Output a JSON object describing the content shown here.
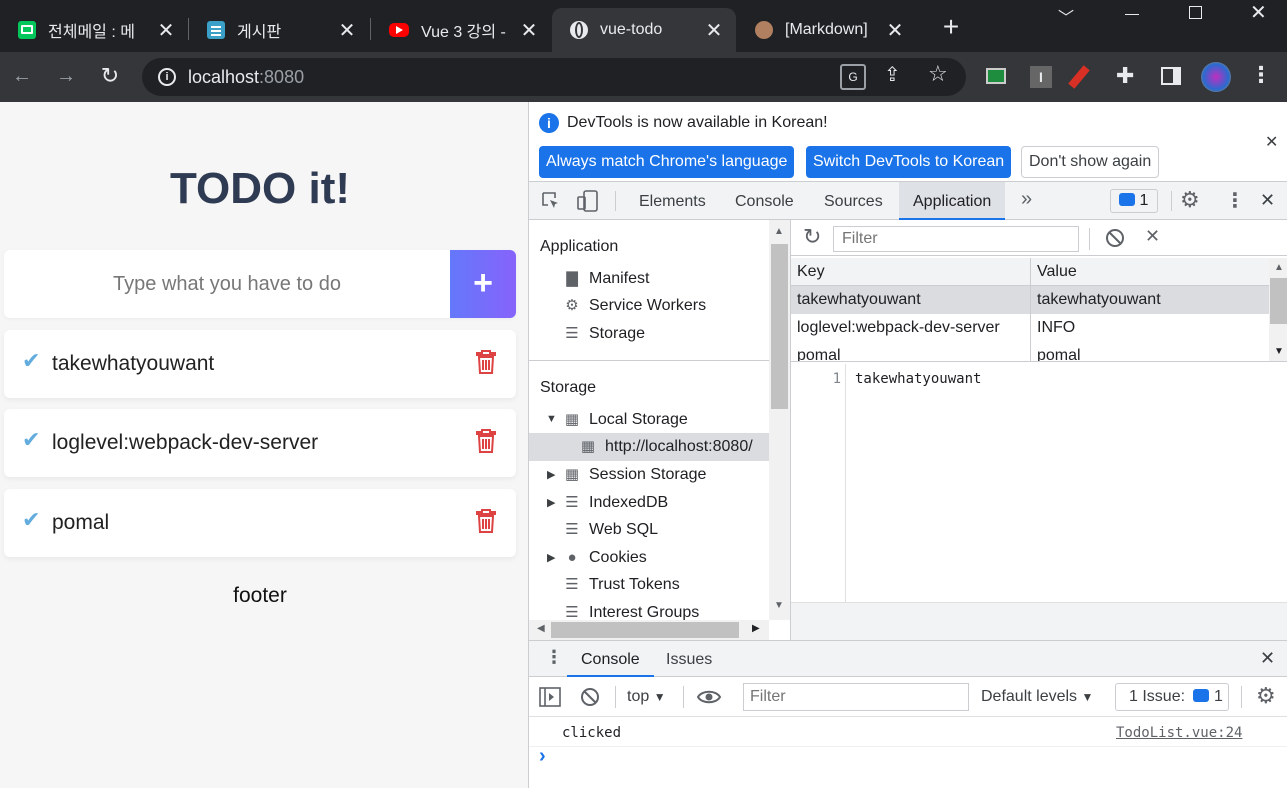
{
  "browser": {
    "tabs": [
      {
        "title": "전체메일 : 메",
        "favicon_color": "#03c75a",
        "icon": "mail-icon"
      },
      {
        "title": "게시판",
        "favicon_color": "#3aa0c8",
        "icon": "clipboard-icon"
      },
      {
        "title": "Vue 3 강의 -",
        "favicon_color": "#ff0000",
        "icon": "youtube-icon"
      },
      {
        "title": "vue-todo",
        "favicon_color": "#e8eaed",
        "icon": "globe-icon",
        "active": true
      },
      {
        "title": "[Markdown]",
        "favicon_color": "#b08060",
        "icon": "avatar-icon"
      }
    ],
    "new_tab": "+",
    "url_host": "localhost",
    "url_port": ":8080"
  },
  "app": {
    "title": "TODO it!",
    "input_placeholder": "Type what you have to do",
    "add_label": "+",
    "todos": [
      "takewhatyouwant",
      "loglevel:webpack-dev-server",
      "pomal"
    ],
    "footer": "footer",
    "colors": {
      "check": "#62acde",
      "trash": "#de4343",
      "add_from": "#6478fb",
      "add_to": "#8763fb",
      "title": "#2f3b52"
    }
  },
  "devtools": {
    "info_text": "DevTools is now available in Korean!",
    "btn_match": "Always match Chrome's language",
    "btn_switch": "Switch DevTools to Korean",
    "btn_dont": "Don't show again",
    "tabs": [
      "Elements",
      "Console",
      "Sources",
      "Application"
    ],
    "active_tab": "Application",
    "more": "»",
    "issues_count": "1",
    "side": {
      "application_header": "Application",
      "application_items": [
        "Manifest",
        "Service Workers",
        "Storage"
      ],
      "storage_header": "Storage",
      "local_storage": "Local Storage",
      "local_origin": "http://localhost:8080/",
      "storage_items": [
        "Session Storage",
        "IndexedDB",
        "Web SQL",
        "Cookies",
        "Trust Tokens",
        "Interest Groups"
      ]
    },
    "filter_placeholder": "Filter",
    "table": {
      "headers": [
        "Key",
        "Value"
      ],
      "rows": [
        {
          "key": "takewhatyouwant",
          "value": "takewhatyouwant"
        },
        {
          "key": "loglevel:webpack-dev-server",
          "value": "INFO"
        },
        {
          "key": "pomal",
          "value": "pomal"
        }
      ]
    },
    "preview": {
      "line": "1",
      "text": "takewhatyouwant"
    },
    "drawer": {
      "tabs": [
        "Console",
        "Issues"
      ],
      "context": "top",
      "filter_placeholder": "Filter",
      "levels": "Default levels",
      "issue_label": "1 Issue:",
      "issue_count": "1",
      "message": "clicked",
      "source": "TodoList.vue:24",
      "prompt": "›"
    }
  }
}
